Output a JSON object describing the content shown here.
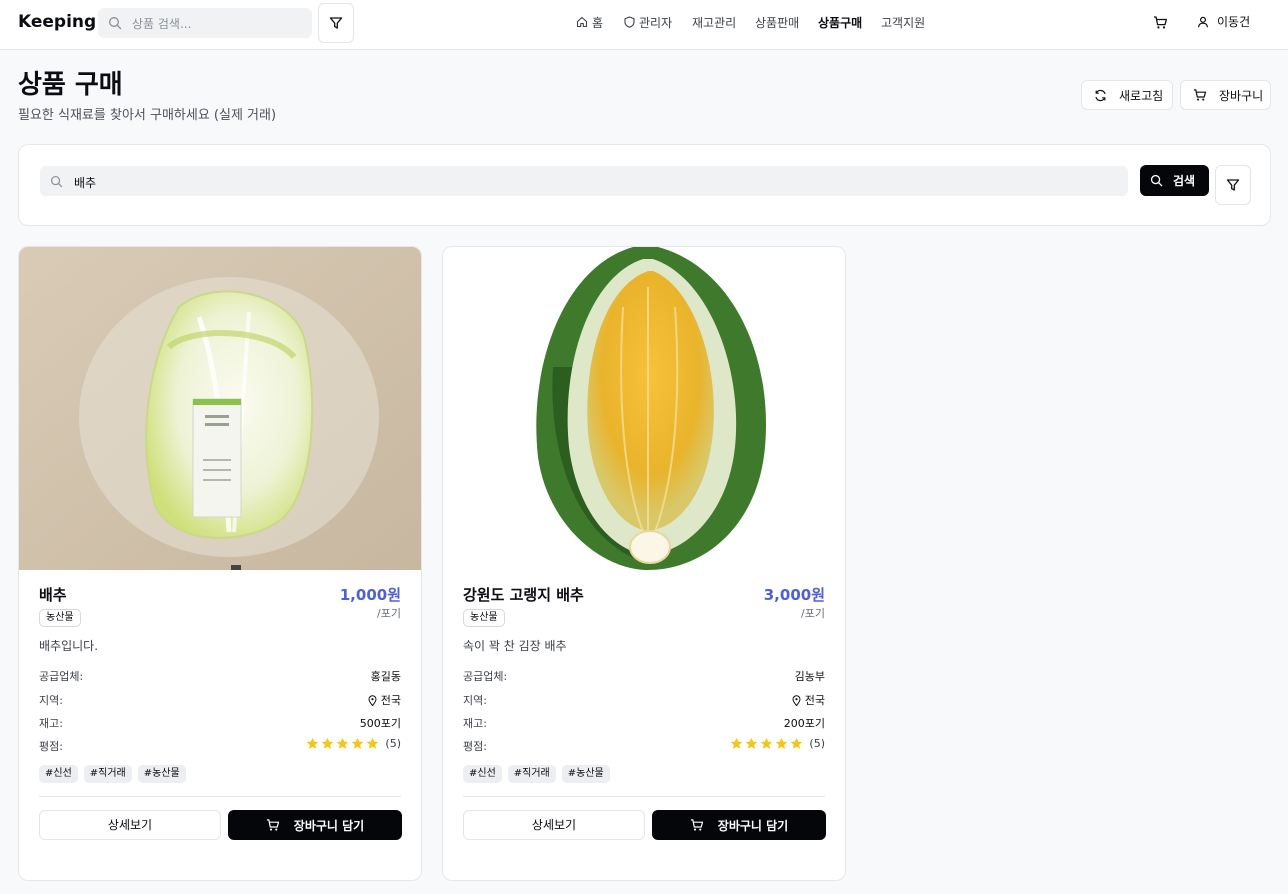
{
  "header": {
    "brand": "Keeping",
    "search_placeholder": "상품 검색...",
    "nav": [
      {
        "label": "홈",
        "icon": "home-icon"
      },
      {
        "label": "관리자",
        "icon": "shield-icon"
      },
      {
        "label": "재고관리"
      },
      {
        "label": "상품판매"
      },
      {
        "label": "상품구매",
        "active": true
      },
      {
        "label": "고객지원"
      }
    ],
    "user_name": "이동건"
  },
  "page": {
    "title": "상품 구매",
    "subtitle": "필요한 식재료를 찾아서 구매하세요 (실제 거래)",
    "refresh_label": "새로고침",
    "cart_label": "장바구니"
  },
  "search": {
    "value": "배추",
    "button_label": "검색"
  },
  "field_labels": {
    "supplier": "공급업체:",
    "region": "지역:",
    "stock": "재고:",
    "rating": "평점:"
  },
  "products": [
    {
      "name": "배추",
      "price": "1,000원",
      "unit": "/포기",
      "category": "농산물",
      "description": "배추입니다.",
      "supplier": "홍길동",
      "region": "전국",
      "stock": "500포기",
      "rating": 5,
      "rating_count": "(5)",
      "tags": [
        "#신선",
        "#직거래",
        "#농산물"
      ],
      "detail_label": "상세보기",
      "add_label": "장바구니 담기"
    },
    {
      "name": "강원도 고랭지 배추",
      "price": "3,000원",
      "unit": "/포기",
      "category": "농산물",
      "description": "속이 꽉 찬 김장 배추",
      "supplier": "김농부",
      "region": "전국",
      "stock": "200포기",
      "rating": 5,
      "rating_count": "(5)",
      "tags": [
        "#신선",
        "#직거래",
        "#농산물"
      ],
      "detail_label": "상세보기",
      "add_label": "장바구니 담기"
    }
  ],
  "colors": {
    "accent_price": "#4f5fd8",
    "star": "#f5c518",
    "primary_button": "#05060a"
  }
}
